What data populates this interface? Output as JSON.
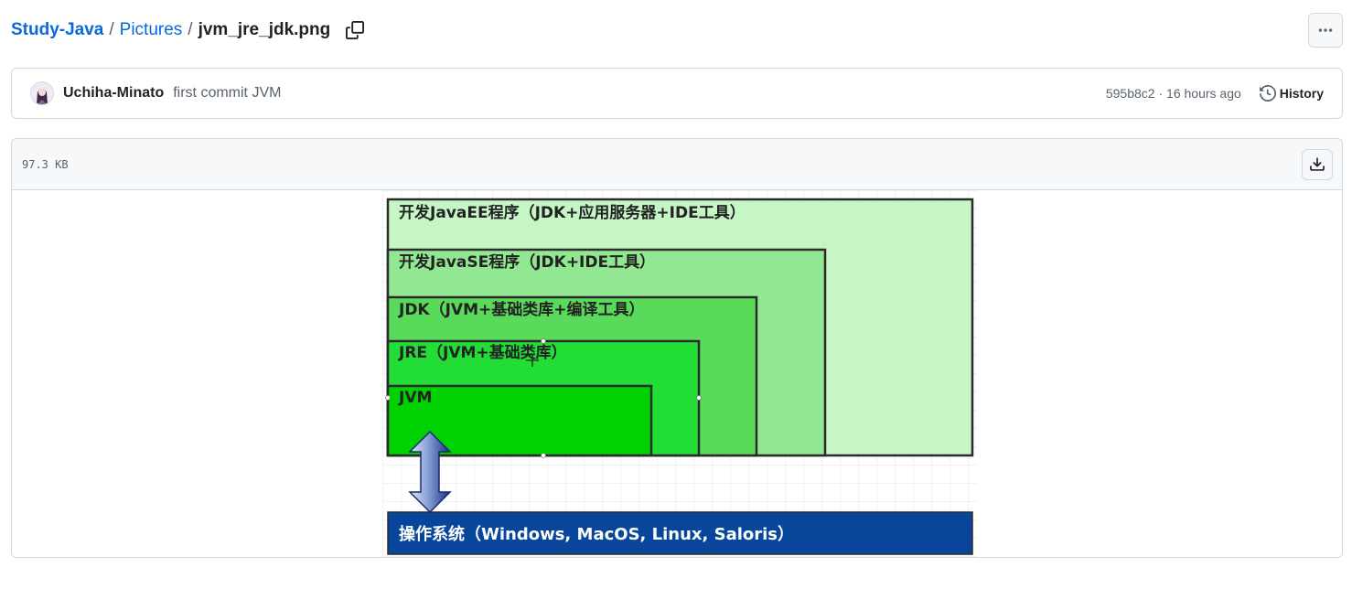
{
  "breadcrumb": {
    "repo": "Study-Java",
    "separator": "/",
    "folder": "Pictures",
    "file": "jvm_jre_jdk.png"
  },
  "commit": {
    "author": "Uchiha-Minato",
    "message": "first commit JVM",
    "sha": "595b8c2",
    "dot": " · ",
    "time": "16 hours ago",
    "history_label": "History"
  },
  "file": {
    "size": "97.3 KB"
  },
  "diagram": {
    "boxes": [
      {
        "label": "开发JavaEE程序（JDK+应用服务器+IDE工具）",
        "color": "#c6f5c6"
      },
      {
        "label": "开发JavaSE程序（JDK+IDE工具）",
        "color": "#92e892"
      },
      {
        "label": "JDK（JVM+基础类库+编译工具）",
        "color": "#5ada5a"
      },
      {
        "label": "JRE（JVM+基础类库）",
        "color": "#22dd36"
      },
      {
        "label": "JVM",
        "color": "#00d100"
      }
    ],
    "os_label": "操作系统（Windows, MacOS, Linux, Saloris）",
    "os_color": "#08469c"
  },
  "icons": {
    "copy": "copy-icon",
    "more": "kebab-horizontal-icon",
    "history": "history-icon",
    "download": "download-icon"
  }
}
